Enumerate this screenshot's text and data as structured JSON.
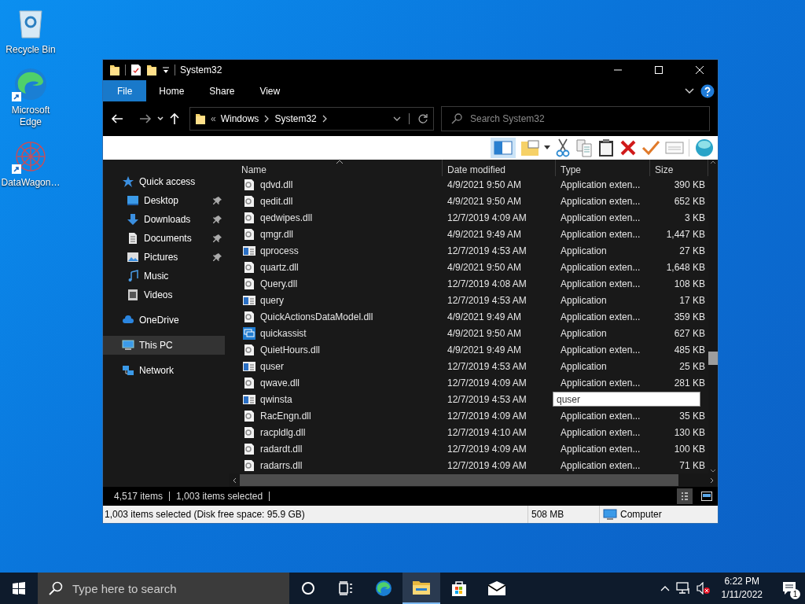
{
  "desktop_icons": [
    {
      "label": "Recycle Bin",
      "kind": "recycle"
    },
    {
      "label": "Microsoft Edge",
      "kind": "edge",
      "shortcut": true
    },
    {
      "label": "DataWagon…",
      "kind": "datawagon",
      "shortcut": true
    }
  ],
  "window": {
    "title": "System32"
  },
  "ribbon_tabs": [
    {
      "label": "File",
      "kind": "file_menu"
    },
    {
      "label": "Home",
      "kind": "tab"
    },
    {
      "label": "Share",
      "kind": "tab"
    },
    {
      "label": "View",
      "kind": "tab"
    }
  ],
  "address": {
    "overflow": "«",
    "crumbs": [
      "Windows",
      "System32"
    ]
  },
  "search": {
    "placeholder": "Search System32"
  },
  "sidebar": {
    "items": [
      {
        "label": "Quick access",
        "kind": "star",
        "selected": false,
        "pinned": false,
        "children": [
          {
            "label": "Desktop",
            "kind": "desktop",
            "selected": false,
            "pinned": true
          },
          {
            "label": "Downloads",
            "kind": "download",
            "selected": false,
            "pinned": true
          },
          {
            "label": "Documents",
            "kind": "documents",
            "selected": false,
            "pinned": true
          },
          {
            "label": "Pictures",
            "kind": "pictures",
            "selected": false,
            "pinned": true
          },
          {
            "label": "Music",
            "kind": "music",
            "selected": false,
            "pinned": false
          },
          {
            "label": "Videos",
            "kind": "videos",
            "selected": false,
            "pinned": false
          }
        ]
      },
      {
        "label": "OneDrive",
        "kind": "cloud",
        "selected": false,
        "pinned": false
      },
      {
        "label": "This PC",
        "kind": "pc",
        "selected": true,
        "pinned": false
      },
      {
        "label": "Network",
        "kind": "network",
        "selected": false,
        "pinned": false
      }
    ]
  },
  "table": {
    "columns": [
      "Name",
      "Date modified",
      "Type",
      "Size"
    ],
    "rows": [
      {
        "kind": "dll",
        "name": "qdvd.dll",
        "date": "4/9/2021 9:50 AM",
        "type": "Application exten...",
        "size": "390 KB"
      },
      {
        "kind": "dll",
        "name": "qedit.dll",
        "date": "4/9/2021 9:50 AM",
        "type": "Application exten...",
        "size": "652 KB"
      },
      {
        "kind": "dll",
        "name": "qedwipes.dll",
        "date": "12/7/2019 4:09 AM",
        "type": "Application exten...",
        "size": "3 KB"
      },
      {
        "kind": "dll",
        "name": "qmgr.dll",
        "date": "4/9/2021 9:49 AM",
        "type": "Application exten...",
        "size": "1,447 KB"
      },
      {
        "kind": "app",
        "name": "qprocess",
        "date": "12/7/2019 4:53 AM",
        "type": "Application",
        "size": "27 KB"
      },
      {
        "kind": "dll",
        "name": "quartz.dll",
        "date": "4/9/2021 9:50 AM",
        "type": "Application exten...",
        "size": "1,648 KB"
      },
      {
        "kind": "dll",
        "name": "Query.dll",
        "date": "12/7/2019 4:08 AM",
        "type": "Application exten...",
        "size": "108 KB"
      },
      {
        "kind": "app",
        "name": "query",
        "date": "12/7/2019 4:53 AM",
        "type": "Application",
        "size": "17 KB"
      },
      {
        "kind": "dll",
        "name": "QuickActionsDataModel.dll",
        "date": "4/9/2021 9:49 AM",
        "type": "Application exten...",
        "size": "359 KB"
      },
      {
        "kind": "assist",
        "name": "quickassist",
        "date": "4/9/2021 9:50 AM",
        "type": "Application",
        "size": "627 KB"
      },
      {
        "kind": "dll",
        "name": "QuietHours.dll",
        "date": "4/9/2021 9:49 AM",
        "type": "Application exten...",
        "size": "485 KB"
      },
      {
        "kind": "app",
        "name": "quser",
        "date": "12/7/2019 4:53 AM",
        "type": "Application",
        "size": "25 KB"
      },
      {
        "kind": "dll",
        "name": "qwave.dll",
        "date": "12/7/2019 4:09 AM",
        "type": "Application exten...",
        "size": "281 KB"
      },
      {
        "kind": "app",
        "name": "qwinsta",
        "date": "12/7/2019 4:53 AM",
        "rename_value": "quser"
      },
      {
        "kind": "dll",
        "name": "RacEngn.dll",
        "date": "12/7/2019 4:09 AM",
        "type": "Application exten...",
        "size": "35 KB"
      },
      {
        "kind": "dll",
        "name": "racpldlg.dll",
        "date": "12/7/2019 4:10 AM",
        "type": "Application exten...",
        "size": "130 KB"
      },
      {
        "kind": "dll",
        "name": "radardt.dll",
        "date": "12/7/2019 4:09 AM",
        "type": "Application exten...",
        "size": "100 KB"
      },
      {
        "kind": "dll",
        "name": "radarrs.dll",
        "date": "12/7/2019 4:09 AM",
        "type": "Application exten...",
        "size": "71 KB"
      }
    ]
  },
  "status_bar": {
    "items": "4,517 items",
    "selected": "1,003 items selected"
  },
  "details_bar": {
    "text": "1,003 items selected (Disk free space: 95.9 GB)",
    "size": "508 MB",
    "location": "Computer"
  },
  "taskbar": {
    "search_placeholder": "Type here to search",
    "apps": [
      {
        "kind": "cortana",
        "active": false
      },
      {
        "kind": "taskview",
        "active": false
      },
      {
        "kind": "edge",
        "active": false
      },
      {
        "kind": "explorer",
        "active": true
      },
      {
        "kind": "store",
        "active": false
      },
      {
        "kind": "mail",
        "active": false
      }
    ],
    "time": "6:22 PM",
    "date": "1/11/2022",
    "notifications": "1"
  }
}
